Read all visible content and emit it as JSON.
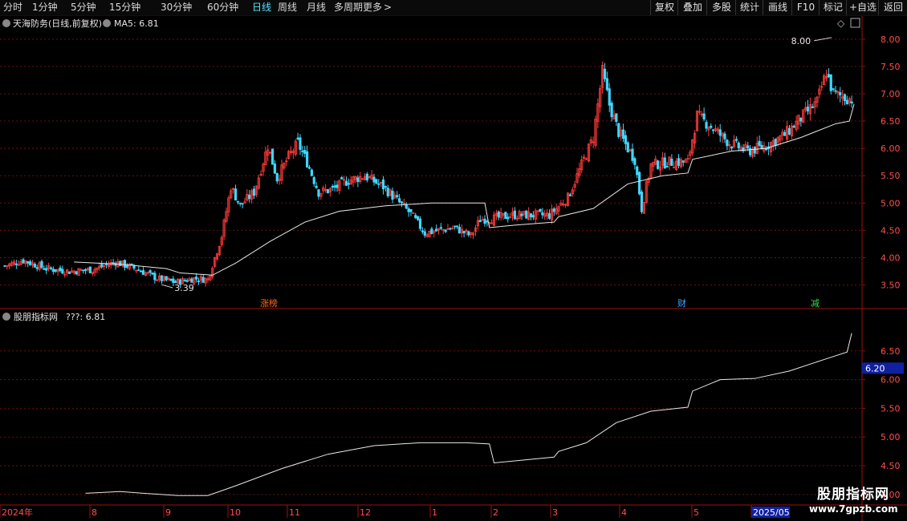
{
  "toolbar": {
    "periods": [
      {
        "label": "分时",
        "active": false
      },
      {
        "label": "1分钟",
        "active": false
      },
      {
        "label": "5分钟",
        "active": false
      },
      {
        "label": "15分钟",
        "active": false
      },
      {
        "label": "30分钟",
        "active": false
      },
      {
        "label": "60分钟",
        "active": false
      },
      {
        "label": "日线",
        "active": true
      },
      {
        "label": "周线",
        "active": false
      },
      {
        "label": "月线",
        "active": false
      },
      {
        "label": "多周期",
        "active": false
      },
      {
        "label": "更多",
        "active": false
      }
    ],
    "more_arrow": ">",
    "buttons": [
      "复权",
      "叠加",
      "多股",
      "统计",
      "画线",
      "F10",
      "标记",
      "+自选",
      "返回"
    ]
  },
  "main_panel": {
    "title": "天海防务(日线,前复权)",
    "ma_label": "MA5: 6.81",
    "high_label": "8.00",
    "low_label": "3.39",
    "badges": [
      {
        "text": "涨榜",
        "color": "#ff6a1a"
      },
      {
        "text": "财",
        "color": "#3fa9ff"
      },
      {
        "text": "减",
        "color": "#2ee04a"
      }
    ],
    "diamond_icon": "◇",
    "y_ticks": [
      "8.00",
      "7.50",
      "7.00",
      "6.50",
      "6.00",
      "5.50",
      "5.00",
      "4.50",
      "4.00",
      "3.50"
    ]
  },
  "sub_panel": {
    "title": "股朋指标网",
    "value_label": "???: 6.81",
    "y_ticks": [
      "6.50",
      "6.00",
      "5.50",
      "5.00",
      "4.50",
      "4.00"
    ],
    "price_tag": "6.20"
  },
  "x_axis": {
    "labels": [
      "2024年",
      "8",
      "9",
      "10",
      "11",
      "12",
      "1",
      "2",
      "3",
      "4",
      "5",
      "2025/05"
    ]
  },
  "watermark": {
    "line1": "股朋指标网",
    "line2": "www.7gpzb.com"
  },
  "colors": {
    "up": "#ff3b3b",
    "down": "#3fd8ff",
    "grid": "#6a1010",
    "axis": "#a01010",
    "line": "#e8e8e8"
  },
  "chart_data": {
    "type": "candlestick",
    "title": "天海防务(日线,前复权)",
    "ylim": [
      3.2,
      8.1
    ],
    "sub_ylim": [
      3.9,
      7.0
    ],
    "ma_current": 6.81,
    "ohlc_anchors": [
      {
        "t": 0,
        "c": 3.85
      },
      {
        "t": 8,
        "c": 3.95
      },
      {
        "t": 18,
        "c": 3.8
      },
      {
        "t": 28,
        "c": 3.75
      },
      {
        "t": 38,
        "c": 3.78
      },
      {
        "t": 48,
        "c": 3.92
      },
      {
        "t": 58,
        "c": 3.78
      },
      {
        "t": 66,
        "c": 3.62
      },
      {
        "t": 74,
        "c": 3.55
      },
      {
        "t": 82,
        "c": 3.62
      },
      {
        "t": 88,
        "c": 3.6
      },
      {
        "t": 94,
        "c": 4.4
      },
      {
        "t": 98,
        "c": 5.3
      },
      {
        "t": 102,
        "c": 4.95
      },
      {
        "t": 108,
        "c": 5.2
      },
      {
        "t": 114,
        "c": 6.05
      },
      {
        "t": 118,
        "c": 5.45
      },
      {
        "t": 123,
        "c": 5.85
      },
      {
        "t": 127,
        "c": 6.1
      },
      {
        "t": 131,
        "c": 5.75
      },
      {
        "t": 136,
        "c": 5.2
      },
      {
        "t": 142,
        "c": 5.25
      },
      {
        "t": 148,
        "c": 5.4
      },
      {
        "t": 156,
        "c": 5.5
      },
      {
        "t": 164,
        "c": 5.3
      },
      {
        "t": 170,
        "c": 5.05
      },
      {
        "t": 176,
        "c": 4.8
      },
      {
        "t": 182,
        "c": 4.45
      },
      {
        "t": 188,
        "c": 4.5
      },
      {
        "t": 195,
        "c": 4.55
      },
      {
        "t": 202,
        "c": 4.4
      },
      {
        "t": 206,
        "c": 4.7
      },
      {
        "t": 212,
        "c": 4.72
      },
      {
        "t": 220,
        "c": 4.78
      },
      {
        "t": 228,
        "c": 4.78
      },
      {
        "t": 236,
        "c": 4.78
      },
      {
        "t": 244,
        "c": 5.1
      },
      {
        "t": 250,
        "c": 5.7
      },
      {
        "t": 255,
        "c": 6.2
      },
      {
        "t": 259,
        "c": 7.4
      },
      {
        "t": 262,
        "c": 6.8
      },
      {
        "t": 266,
        "c": 6.3
      },
      {
        "t": 270,
        "c": 6.0
      },
      {
        "t": 273,
        "c": 5.8
      },
      {
        "t": 276,
        "c": 4.9
      },
      {
        "t": 280,
        "c": 5.7
      },
      {
        "t": 288,
        "c": 5.75
      },
      {
        "t": 296,
        "c": 5.75
      },
      {
        "t": 300,
        "c": 6.6
      },
      {
        "t": 306,
        "c": 6.4
      },
      {
        "t": 314,
        "c": 6.1
      },
      {
        "t": 322,
        "c": 5.95
      },
      {
        "t": 330,
        "c": 6.05
      },
      {
        "t": 338,
        "c": 6.25
      },
      {
        "t": 346,
        "c": 6.6
      },
      {
        "t": 352,
        "c": 6.85
      },
      {
        "t": 356,
        "c": 7.4
      },
      {
        "t": 359,
        "c": 7.0
      },
      {
        "t": 363,
        "c": 6.95
      },
      {
        "t": 367,
        "c": 6.9
      }
    ],
    "indicator_line": [
      {
        "t": 35,
        "v": 4.02
      },
      {
        "t": 50,
        "v": 4.05
      },
      {
        "t": 60,
        "v": 4.02
      },
      {
        "t": 75,
        "v": 3.98
      },
      {
        "t": 88,
        "v": 3.98
      },
      {
        "t": 100,
        "v": 4.15
      },
      {
        "t": 120,
        "v": 4.45
      },
      {
        "t": 140,
        "v": 4.7
      },
      {
        "t": 160,
        "v": 4.85
      },
      {
        "t": 180,
        "v": 4.9
      },
      {
        "t": 200,
        "v": 4.9
      },
      {
        "t": 210,
        "v": 4.88
      },
      {
        "t": 212,
        "v": 4.55
      },
      {
        "t": 225,
        "v": 4.6
      },
      {
        "t": 238,
        "v": 4.65
      },
      {
        "t": 240,
        "v": 4.75
      },
      {
        "t": 252,
        "v": 4.9
      },
      {
        "t": 265,
        "v": 5.25
      },
      {
        "t": 280,
        "v": 5.45
      },
      {
        "t": 296,
        "v": 5.52
      },
      {
        "t": 298,
        "v": 5.8
      },
      {
        "t": 310,
        "v": 6.0
      },
      {
        "t": 325,
        "v": 6.02
      },
      {
        "t": 340,
        "v": 6.15
      },
      {
        "t": 355,
        "v": 6.35
      },
      {
        "t": 365,
        "v": 6.48
      },
      {
        "t": 367,
        "v": 6.81
      }
    ],
    "ma_line": [
      {
        "t": 30,
        "v": 3.92
      },
      {
        "t": 50,
        "v": 3.88
      },
      {
        "t": 70,
        "v": 3.8
      },
      {
        "t": 76,
        "v": 3.72
      },
      {
        "t": 90,
        "v": 3.68
      },
      {
        "t": 100,
        "v": 3.9
      },
      {
        "t": 115,
        "v": 4.3
      },
      {
        "t": 130,
        "v": 4.65
      },
      {
        "t": 145,
        "v": 4.85
      },
      {
        "t": 165,
        "v": 4.95
      },
      {
        "t": 185,
        "v": 5.0
      },
      {
        "t": 208,
        "v": 5.0
      },
      {
        "t": 210,
        "v": 4.55
      },
      {
        "t": 222,
        "v": 4.6
      },
      {
        "t": 238,
        "v": 4.65
      },
      {
        "t": 240,
        "v": 4.75
      },
      {
        "t": 255,
        "v": 4.9
      },
      {
        "t": 270,
        "v": 5.35
      },
      {
        "t": 285,
        "v": 5.5
      },
      {
        "t": 296,
        "v": 5.55
      },
      {
        "t": 298,
        "v": 5.8
      },
      {
        "t": 315,
        "v": 5.95
      },
      {
        "t": 330,
        "v": 6.0
      },
      {
        "t": 345,
        "v": 6.2
      },
      {
        "t": 360,
        "v": 6.45
      },
      {
        "t": 366,
        "v": 6.5
      },
      {
        "t": 368,
        "v": 6.81
      }
    ]
  }
}
